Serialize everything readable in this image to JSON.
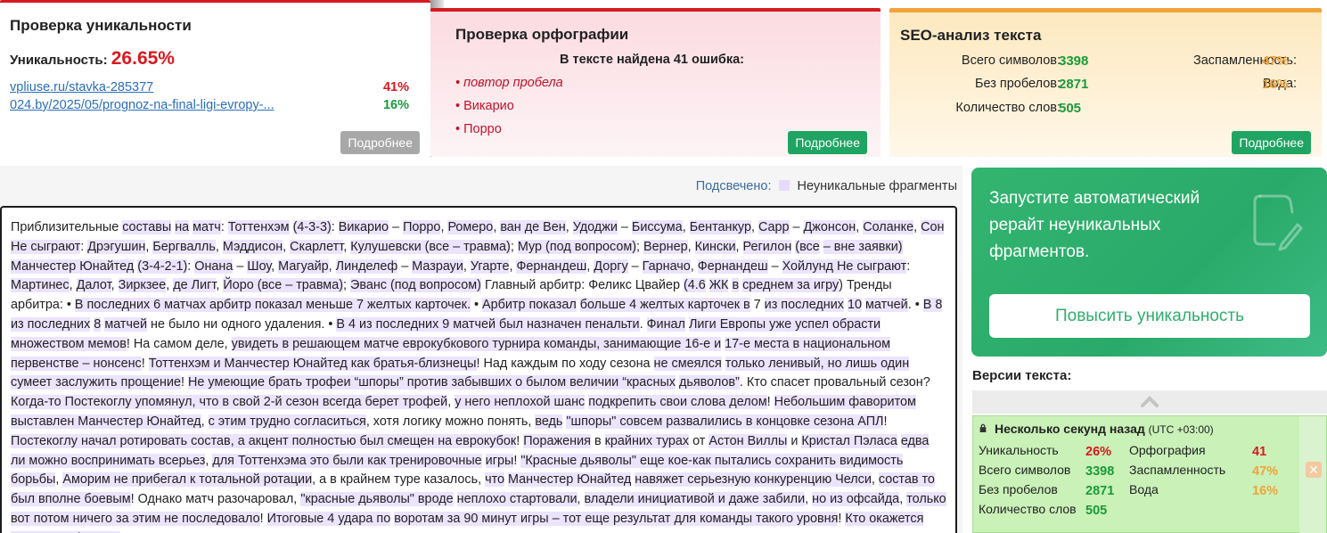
{
  "uniqueness_card": {
    "title": "Проверка уникальности",
    "uniq_label": "Уникальность:",
    "uniq_value": "26.65%",
    "sources": [
      {
        "url": "vpliuse.ru/stavka-285377",
        "percent": "41%",
        "color": "#d71920"
      },
      {
        "url": "024.by/2025/05/prognoz-na-final-ligi-evropy-...",
        "percent": "16%",
        "color": "#1a9a3a"
      }
    ],
    "more_label": "Подробнее"
  },
  "spelling_card": {
    "title": "Проверка орфографии",
    "summary": "В тексте найдена 41 ошибка:",
    "errors": [
      "• повтор пробела",
      "• Викарио",
      "• Порро"
    ],
    "more_label": "Подробнее"
  },
  "seo_card": {
    "title": "SEO-анализ текста",
    "total_chars_label": "Всего символов:",
    "total_chars": "3398",
    "no_spaces_label": "Без пробелов:",
    "no_spaces": "2871",
    "words_label": "Количество слов:",
    "words": "505",
    "spam_label": "Заспамленность:",
    "spam": "47%",
    "water_label": "Вода:",
    "water": "16%",
    "more_label": "Подробнее"
  },
  "legend": {
    "label": "Подсвечено:",
    "text": "Неуникальные фрагменты"
  },
  "highlight_color": "#ece3fe",
  "text_segments": [
    [
      "Приблизительные ",
      0
    ],
    [
      "составы",
      1
    ],
    [
      " ",
      0
    ],
    [
      "на",
      1
    ],
    [
      " ",
      0
    ],
    [
      "матч",
      1
    ],
    [
      ":  ",
      0
    ],
    [
      "Тоттенхэм",
      1
    ],
    [
      " ",
      0
    ],
    [
      "(4-3-3)",
      1
    ],
    [
      ": ",
      0
    ],
    [
      "Викарио",
      1
    ],
    [
      " – ",
      0
    ],
    [
      "Порро",
      1
    ],
    [
      ", ",
      0
    ],
    [
      "Ромеро",
      1
    ],
    [
      ", ",
      0
    ],
    [
      "ван де Вен",
      1
    ],
    [
      ", ",
      0
    ],
    [
      "Удоджи",
      1
    ],
    [
      " – ",
      0
    ],
    [
      "Биссума",
      1
    ],
    [
      ", ",
      0
    ],
    [
      "Бентанкур",
      1
    ],
    [
      ", ",
      0
    ],
    [
      "Сарр",
      1
    ],
    [
      " – ",
      0
    ],
    [
      "Джонсон",
      1
    ],
    [
      ", ",
      0
    ],
    [
      "Соланке",
      1
    ],
    [
      ", ",
      0
    ],
    [
      "Сон Не сыграют",
      1
    ],
    [
      ": ",
      0
    ],
    [
      "Дрэгушин",
      1
    ],
    [
      ", ",
      0
    ],
    [
      "Бергвалль",
      1
    ],
    [
      ", ",
      0
    ],
    [
      "Мэддисон",
      1
    ],
    [
      ", ",
      0
    ],
    [
      "Скарлетт",
      1
    ],
    [
      ", ",
      0
    ],
    [
      "Кулушевски (все – травма)",
      1
    ],
    [
      "; ",
      0
    ],
    [
      "Мур (под вопросом)",
      1
    ],
    [
      "; ",
      0
    ],
    [
      "Вернер",
      1
    ],
    [
      ", ",
      0
    ],
    [
      "Кински",
      1
    ],
    [
      ", ",
      0
    ],
    [
      "Регилон",
      1
    ],
    [
      " ",
      0
    ],
    [
      "(все",
      1
    ],
    [
      " ",
      0
    ],
    [
      "– вне заявки)",
      1
    ],
    [
      "  ",
      0
    ],
    [
      "Манчестер Юнайтед",
      1
    ],
    [
      " ",
      0
    ],
    [
      "(3-4-2-1)",
      1
    ],
    [
      ": ",
      0
    ],
    [
      "Онана",
      1
    ],
    [
      " – ",
      0
    ],
    [
      "Шоу",
      1
    ],
    [
      ", ",
      0
    ],
    [
      "Магуайр",
      1
    ],
    [
      ", ",
      0
    ],
    [
      "Линделеф",
      1
    ],
    [
      " – ",
      0
    ],
    [
      "Мазрауи",
      1
    ],
    [
      ", ",
      0
    ],
    [
      "Угарте",
      1
    ],
    [
      ", ",
      0
    ],
    [
      "Фернандеш",
      1
    ],
    [
      ", ",
      0
    ],
    [
      "Доргу",
      1
    ],
    [
      " – ",
      0
    ],
    [
      "Гарначо",
      1
    ],
    [
      ", ",
      0
    ],
    [
      "Фернандеш",
      1
    ],
    [
      " – ",
      0
    ],
    [
      "Хойлунд Не сыграют",
      1
    ],
    [
      ": ",
      0
    ],
    [
      "Мартинес",
      1
    ],
    [
      ", ",
      0
    ],
    [
      "Далот",
      1
    ],
    [
      ", ",
      0
    ],
    [
      "Зиркзее",
      1
    ],
    [
      ", ",
      0
    ],
    [
      "де Лигт",
      1
    ],
    [
      ", ",
      0
    ],
    [
      "Йоро (все – травма)",
      1
    ],
    [
      "; ",
      0
    ],
    [
      "Эванс (под вопросом)",
      1
    ],
    [
      "  Главный арбитр: Феликс Цвайер ",
      0
    ],
    [
      "(4.6",
      1
    ],
    [
      " ",
      0
    ],
    [
      "ЖК",
      1
    ],
    [
      " ",
      0
    ],
    [
      "в",
      1
    ],
    [
      " ",
      0
    ],
    [
      "среднем за игру",
      1
    ],
    [
      ") Тренды арбитра: • ",
      0
    ],
    [
      "В последних 6 матчах арбитр показал меньше 7 желтых карточек.",
      1
    ],
    [
      " • ",
      0
    ],
    [
      "Арбитр показал",
      1
    ],
    [
      " ",
      0
    ],
    [
      "больше 4 желтых карточек в",
      1
    ],
    [
      " ",
      0
    ],
    [
      "7",
      0
    ],
    [
      " ",
      0
    ],
    [
      "из последних",
      1
    ],
    [
      " ",
      0
    ],
    [
      "10",
      1
    ],
    [
      " ",
      0
    ],
    [
      "матчей",
      1
    ],
    [
      ". • ",
      0
    ],
    [
      "В 8",
      1
    ],
    [
      " ",
      0
    ],
    [
      "из последних",
      1
    ],
    [
      " ",
      0
    ],
    [
      "8",
      1
    ],
    [
      " ",
      0
    ],
    [
      "матчей",
      1
    ],
    [
      " не было ни одного удаления. • ",
      0
    ],
    [
      "В 4 из последних 9 матчей был назначен пенальти",
      1
    ],
    [
      ".  ",
      0
    ],
    [
      "Финал",
      1
    ],
    [
      " ",
      0
    ],
    [
      "Лиги Европы уже успел обрасти множеством мемов",
      1
    ],
    [
      "! На самом деле, ",
      0
    ],
    [
      "увидеть в решающем матче еврокубкового турнира команды, занимающие 16-е и",
      1
    ],
    [
      " ",
      0
    ],
    [
      "17-е места в национальном первенстве – нонсенс",
      1
    ],
    [
      "! ",
      0
    ],
    [
      "Тоттенхэм и Манчестер Юнайтед как братья-близнецы",
      1
    ],
    [
      "! Над каждым по ходу сезона ",
      0
    ],
    [
      "не смеялся",
      1
    ],
    [
      " ",
      0
    ],
    [
      "только ленивый, но лишь один сумеет заслужить прощение",
      1
    ],
    [
      "! ",
      0
    ],
    [
      "Не умеющие брать трофеи “шпоры” против забывших о былом величии “красных",
      1
    ],
    [
      " ",
      0
    ],
    [
      "дьяволов”",
      1
    ],
    [
      ". Кто спасет провальный сезон? ",
      0
    ],
    [
      "Когда-то Постекоглу упомянул, что в свой 2-й сезон всегда берет трофей",
      1
    ],
    [
      ", ",
      0
    ],
    [
      "у него неплохой шанс",
      1
    ],
    [
      " ",
      0
    ],
    [
      "подкрепить свои слова делом",
      1
    ],
    [
      "! ",
      0
    ],
    [
      "Небольшим фаворитом выставлен Манчестер Юнайтед",
      1
    ],
    [
      ", ",
      0
    ],
    [
      "с этим трудно согласиться",
      1
    ],
    [
      ", хотя логику можно понять, ",
      0
    ],
    [
      "ведь",
      1
    ],
    [
      " ",
      0
    ],
    [
      "\"шпоры\" совсем развалились в концовке сезона АПЛ",
      1
    ],
    [
      "! ",
      0
    ],
    [
      "Постекоглу начал ротировать состав, а акцент полностью был смещен на еврокубок",
      1
    ],
    [
      "! ",
      0
    ],
    [
      "Поражения",
      1
    ],
    [
      " в ",
      0
    ],
    [
      "крайних турах",
      1
    ],
    [
      " от ",
      0
    ],
    [
      "Астон Виллы",
      1
    ],
    [
      " и ",
      0
    ],
    [
      "Кристал Пэласа",
      1
    ],
    [
      " ",
      0
    ],
    [
      "едва ли можно воспринимать всерьез",
      1
    ],
    [
      ", ",
      0
    ],
    [
      "для Тоттенхэма это были как тренировочные",
      1
    ],
    [
      " ",
      0
    ],
    [
      "игры",
      1
    ],
    [
      "! ",
      0
    ],
    [
      "\"Красные дьяволы\" еще кое-как пытались сохранить видимость борьбы",
      1
    ],
    [
      ", ",
      0
    ],
    [
      "Аморим не прибегал к тотальной ротации",
      1
    ],
    [
      ", а в крайнем туре казалось, ",
      0
    ],
    [
      "что",
      1
    ],
    [
      " ",
      0
    ],
    [
      "Манчестер Юнайтед",
      1
    ],
    [
      " ",
      0
    ],
    [
      "навяжет серьезную конкуренцию Челси",
      1
    ],
    [
      ", ",
      0
    ],
    [
      "состав то был вполне боевым",
      1
    ],
    [
      "! Однако матч разочаровал, ",
      0
    ],
    [
      "\"красные дьяволы\" вроде",
      1
    ],
    [
      " ",
      0
    ],
    [
      "неплохо стартовали",
      1
    ],
    [
      ", ",
      0
    ],
    [
      "владели инициативой и даже забили",
      1
    ],
    [
      ", ",
      0
    ],
    [
      "но из офсайда",
      1
    ],
    [
      ", ",
      0
    ],
    [
      "только вот потом ничего за этим не последовало",
      1
    ],
    [
      "! ",
      0
    ],
    [
      "Итоговые 4 удара по",
      1
    ],
    [
      " ",
      0
    ],
    [
      "воротам за 90 минут игры – тот еще результат для команды такого уровня",
      1
    ],
    [
      "! ",
      0
    ],
    [
      "Кто окажется сильнее в финале",
      1
    ],
    [
      "?",
      0
    ]
  ],
  "rewrite_banner": {
    "text": "Запустите автоматический рерайт неуникальных фрагментов.",
    "button_label": "Повысить уникальность"
  },
  "versions": {
    "title": "Версии текста:",
    "entry": {
      "time": "Несколько секунд назад",
      "tz": "(UTC +03:00)",
      "uniq_label": "Уникальность",
      "uniq": "26%",
      "spell_label": "Орфография",
      "spell": "41",
      "chars_label": "Всего символов",
      "chars": "3398",
      "spam_label": "Заспамленность",
      "spam": "47%",
      "nospace_label": "Без пробелов",
      "nospace": "2871",
      "water_label": "Вода",
      "water": "16%",
      "words_label": "Количество слов",
      "words": "505"
    }
  }
}
